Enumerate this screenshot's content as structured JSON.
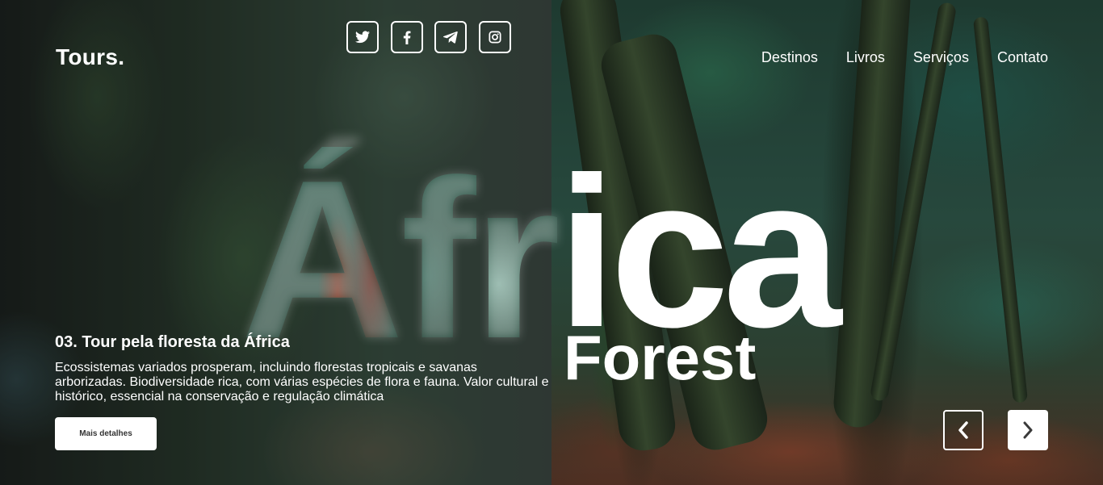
{
  "header": {
    "logo": "Tours.",
    "social": [
      {
        "icon": "twitter-icon"
      },
      {
        "icon": "facebook-icon"
      },
      {
        "icon": "telegram-icon"
      },
      {
        "icon": "instagram-icon"
      }
    ],
    "nav": [
      "Destinos",
      "Livros",
      "Serviços",
      "Contato"
    ]
  },
  "hero": {
    "title_left": "Áfr",
    "title_right": "ica",
    "subtitle": "Forest"
  },
  "tour": {
    "title": "03. Tour pela floresta da África",
    "description": "Ecossistemas variados prosperam, incluindo florestas tropicais e savanas arborizadas. Biodiversidade rica, com várias espécies de flora e fauna. Valor cultural e histórico, essencial na conservação e regulação climática",
    "button_label": "Mais detalhes"
  },
  "controls": {
    "prev_icon": "chevron-left-icon",
    "next_icon": "chevron-right-icon"
  },
  "colors": {
    "text": "#ffffff",
    "button_bg": "#ffffff",
    "button_text": "#333333"
  }
}
